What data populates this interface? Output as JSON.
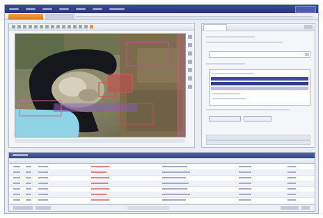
{
  "menubar": {
    "items": [
      "",
      "",
      "",
      "",
      "",
      "",
      ""
    ]
  },
  "tabs": {
    "active": "",
    "inactive": ""
  },
  "map": {
    "toolbar_buttons": 18,
    "highlight_color": "#ef8f2c",
    "overlay_color": "#d04848"
  },
  "right_panel": {
    "tab_label": "",
    "selected_rows": 2
  },
  "grid": {
    "header_color": "#3d4a9a",
    "rows": 8
  }
}
